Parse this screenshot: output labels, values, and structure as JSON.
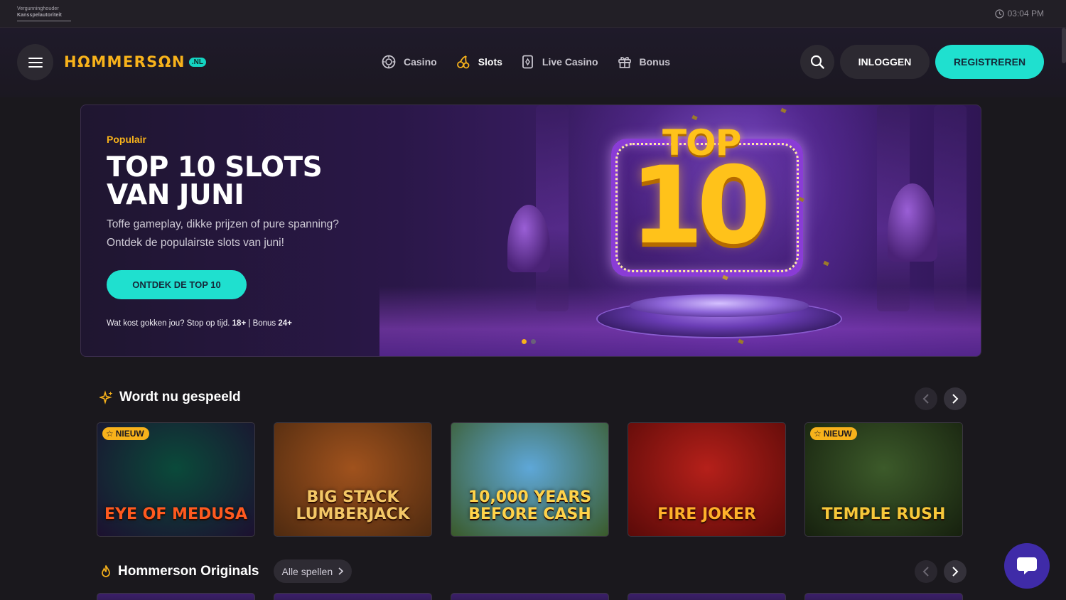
{
  "regulator": {
    "line1": "Vergunninghouder",
    "line2": "Kansspelautoriteit"
  },
  "clock": {
    "time": "03:04 PM",
    "icon": "clock-icon"
  },
  "header": {
    "logo": {
      "text": "HΩMMERSΩN",
      "suffix": ".NL"
    },
    "nav": [
      {
        "label": "Casino",
        "icon": "casino-chip-icon"
      },
      {
        "label": "Slots",
        "icon": "cherries-icon"
      },
      {
        "label": "Live Casino",
        "icon": "playing-card-icon"
      },
      {
        "label": "Bonus",
        "icon": "gift-icon"
      }
    ],
    "login_label": "INLOGGEN",
    "register_label": "REGISTREREN"
  },
  "hero": {
    "eyebrow": "Populair",
    "title_line1": "TOP 10 SLOTS",
    "title_line2": "VAN JUNI",
    "desc_line1": "Toffe gameplay, dikke prijzen of pure spanning?",
    "desc_line2": "Ontdek de populairste slots van juni!",
    "cta": "ONTDEK DE TOP 10",
    "disclaimer": {
      "text": "Wat kost gokken jou? Stop op tijd.",
      "age": "18+",
      "sep": "|",
      "bonus_text": "Bonus",
      "bonus_age": "24+"
    },
    "image_top": "TOP",
    "image_ten": "10",
    "slides": 2,
    "active_slide": 1
  },
  "section_playing": {
    "title": "Wordt nu gespeeld",
    "icon": "sparkles-icon",
    "games": [
      {
        "title": "EYE OF MEDUSA",
        "badge": "NIEUW",
        "colors": [
          "#0a4a3a",
          "#1c1030"
        ],
        "text_color": "#ff5a1f"
      },
      {
        "title": "BIG STACK LUMBERJACK",
        "badge": "",
        "colors": [
          "#a0521d",
          "#4e2a10"
        ],
        "text_color": "#f3c766"
      },
      {
        "title": "10,000 YEARS BEFORE CASH",
        "badge": "",
        "colors": [
          "#5ea7d8",
          "#3a5a2a"
        ],
        "text_color": "#ffd34a"
      },
      {
        "title": "FIRE JOKER",
        "badge": "",
        "colors": [
          "#b5201a",
          "#5a0a08"
        ],
        "text_color": "#ffb02a"
      },
      {
        "title": "TEMPLE RUSH",
        "badge": "NIEUW",
        "colors": [
          "#3c5a2a",
          "#16200e"
        ],
        "text_color": "#f7c83a"
      }
    ]
  },
  "section_originals": {
    "title": "Hommerson Originals",
    "icon": "flame-icon",
    "all_games": "Alle spellen"
  },
  "colors": {
    "accent": "#1fe0cf",
    "gold": "#f7b21b",
    "chat": "#3f2ba8"
  }
}
